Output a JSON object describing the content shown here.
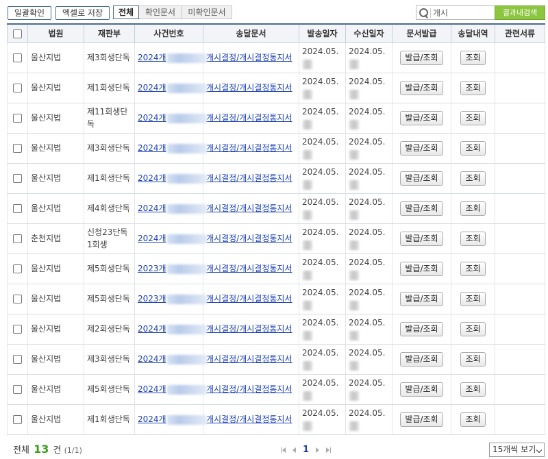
{
  "toolbar": {
    "bulk_confirm": "일괄확인",
    "excel_save": "엑셀로 저장",
    "filters": [
      "전체",
      "확인문서",
      "미확인문서"
    ],
    "active_filter": 0,
    "search_value": "개시",
    "search_button": "결과내검색"
  },
  "columns": [
    "법원",
    "재판부",
    "사건번호",
    "송달문서",
    "발송일자",
    "수신일자",
    "문서발급",
    "송달내역",
    "관련서류"
  ],
  "rows": [
    {
      "court": "울산지법",
      "division": "제3회생단독",
      "case_prefix": "2024개",
      "document": "개시결정/개시결정통지서",
      "sent": "2024.05.",
      "received": "2024.05.",
      "issue": "발급/조회",
      "history": "조회"
    },
    {
      "court": "울산지법",
      "division": "제1회생단독",
      "case_prefix": "2024개",
      "document": "개시결정/개시결정통지서",
      "sent": "2024.05.",
      "received": "2024.05.",
      "issue": "발급/조회",
      "history": "조회"
    },
    {
      "court": "울산지법",
      "division": "제11회생단독",
      "case_prefix": "2024개",
      "document": "개시결정/개시결정통지서",
      "sent": "2024.05.",
      "received": "2024.05.",
      "issue": "발급/조회",
      "history": "조회"
    },
    {
      "court": "울산지법",
      "division": "제3회생단독",
      "case_prefix": "2024개",
      "document": "개시결정/개시결정통지서",
      "sent": "2024.05.",
      "received": "2024.05.",
      "issue": "발급/조회",
      "history": "조회"
    },
    {
      "court": "울산지법",
      "division": "제1회생단독",
      "case_prefix": "2024개",
      "document": "개시결정/개시결정통지서",
      "sent": "2024.05.",
      "received": "2024.05.",
      "issue": "발급/조회",
      "history": "조회"
    },
    {
      "court": "울산지법",
      "division": "제4회생단독",
      "case_prefix": "2024개",
      "document": "개시결정/개시결정통지서",
      "sent": "2024.05.",
      "received": "2024.05.",
      "issue": "발급/조회",
      "history": "조회"
    },
    {
      "court": "춘천지법",
      "division": "신청23단독 1회생",
      "case_prefix": "2024개",
      "document": "개시결정/개시결정통지서",
      "sent": "2024.05.",
      "received": "2024.05.",
      "issue": "발급/조회",
      "history": "조회"
    },
    {
      "court": "울산지법",
      "division": "제5회생단독",
      "case_prefix": "2023개",
      "document": "개시결정/개시결정통지서",
      "sent": "2024.05.",
      "received": "2024.05.",
      "issue": "발급/조회",
      "history": "조회"
    },
    {
      "court": "울산지법",
      "division": "제5회생단독",
      "case_prefix": "2023개",
      "document": "개시결정/개시결정통지서",
      "sent": "2024.05.",
      "received": "2024.05.",
      "issue": "발급/조회",
      "history": "조회"
    },
    {
      "court": "울산지법",
      "division": "제2회생단독",
      "case_prefix": "2024개",
      "document": "개시결정/개시결정통지서",
      "sent": "2024.05.",
      "received": "2024.05.",
      "issue": "발급/조회",
      "history": "조회"
    },
    {
      "court": "울산지법",
      "division": "제3회생단독",
      "case_prefix": "2024개",
      "document": "개시결정/개시결정통지서",
      "sent": "2024.05.",
      "received": "2024.05.",
      "issue": "발급/조회",
      "history": "조회"
    },
    {
      "court": "울산지법",
      "division": "제5회생단독",
      "case_prefix": "2024개",
      "document": "개시결정/개시결정통지서",
      "sent": "2024.05.",
      "received": "2024.05.",
      "issue": "발급/조회",
      "history": "조회"
    },
    {
      "court": "울산지법",
      "division": "제1회생단독",
      "case_prefix": "2024개",
      "document": "개시결정/개시결정통지서",
      "sent": "2024.05.",
      "received": "2024.05.",
      "issue": "발급/조회",
      "history": "조회"
    }
  ],
  "footer": {
    "total_label": "전체",
    "total_count": "13",
    "total_unit": "건",
    "paging_text": "(1/1)",
    "current_page": "1",
    "page_size": "15개씩 보기"
  },
  "colors": {
    "accent_green": "#8cc540",
    "count_green": "#3e9c1e",
    "link_blue": "#1a3fb5",
    "header_border": "#4a6b8a"
  }
}
